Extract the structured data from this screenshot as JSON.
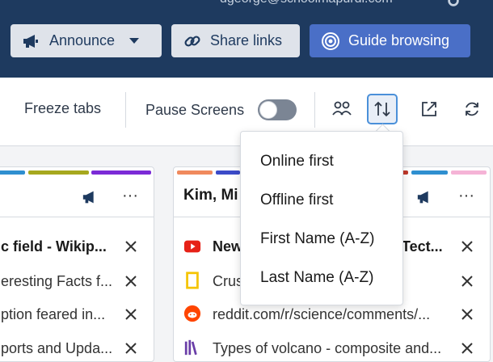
{
  "header": {
    "email": "dgeorge@schoolmapurdi.com",
    "announce_label": "Announce",
    "share_label": "Share links",
    "guide_label": "Guide browsing"
  },
  "toolbar": {
    "freeze_label": "Freeze tabs",
    "pause_label": "Pause Screens",
    "pause_on": false
  },
  "sort_menu": {
    "items": [
      "Online first",
      "Offline first",
      "First Name (A-Z)",
      "Last Name (A-Z)"
    ]
  },
  "cards": {
    "left": {
      "stripe_colors": [
        "#2f8fd0",
        "#a6a81e",
        "#7b2bd6"
      ],
      "rows": [
        "c field - Wikip...",
        "eresting Facts f...",
        "ption feared in...",
        "ports and Upda..."
      ]
    },
    "right": {
      "name": "Kim, Mi",
      "stripe_colors": [
        "#f08a5d",
        "#3b4bc8",
        "#c0392b",
        "#2f8fd0",
        "#f5b3d6"
      ],
      "rows": [
        {
          "text": "New",
          "tail": "Tect...",
          "icon": "youtube-icon"
        },
        {
          "text": "Crus",
          "icon": "natgeo-icon"
        },
        {
          "text": "reddit.com/r/science/comments/...",
          "icon": "reddit-icon"
        },
        {
          "text": "Types of volcano - composite and...",
          "icon": "books-icon"
        }
      ]
    }
  },
  "colors": {
    "header_bg": "#1e3a5f",
    "guide_button": "#4a6fc7",
    "active_outline": "#4a90d9"
  }
}
